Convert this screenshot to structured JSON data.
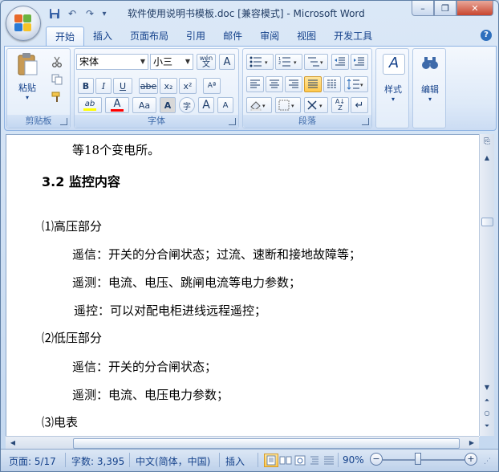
{
  "window": {
    "title": "软件使用说明书模板.doc [兼容模式] - Microsoft Word",
    "minimize_glyph": "–",
    "restore_glyph": "❐",
    "close_glyph": "✕"
  },
  "quick_access": {
    "save_icon": "save-icon",
    "undo_glyph": "↶",
    "redo_glyph": "↷",
    "customize_glyph": "▾"
  },
  "tabs": [
    {
      "label": "开始",
      "active": true
    },
    {
      "label": "插入"
    },
    {
      "label": "页面布局"
    },
    {
      "label": "引用"
    },
    {
      "label": "邮件"
    },
    {
      "label": "审阅"
    },
    {
      "label": "视图"
    },
    {
      "label": "开发工具"
    }
  ],
  "help_glyph": "?",
  "ribbon": {
    "clipboard": {
      "label": "剪贴板",
      "paste_label": "粘贴"
    },
    "font": {
      "label": "字体",
      "font_name": "宋体",
      "font_size": "小三",
      "phonetic_label": "wén",
      "bold": "B",
      "italic": "I",
      "underline": "U",
      "strike": "abe",
      "subscript": "x₂",
      "superscript": "x²",
      "grow": "A",
      "shrink": "A",
      "text_color_glyph": "A",
      "change_case": "Aa",
      "char_shading": "A",
      "enclose": "字",
      "highlight_glyph": "ab"
    },
    "paragraph": {
      "label": "段落"
    },
    "styles": {
      "label": "样式"
    },
    "editing": {
      "label": "编辑"
    }
  },
  "document": {
    "lines": [
      {
        "text": "等18个变电所。"
      },
      {
        "text": "3.2  监控内容",
        "heading": true
      },
      {
        "text": "⑴高压部分"
      },
      {
        "text": "遥信：开关的分合闸状态；过流、速断和接地故障等；"
      },
      {
        "text": "遥测：电流、电压、跳闸电流等电力参数；"
      },
      {
        "text": "遥控：可以对配电柜进线远程遥控；"
      },
      {
        "text": "⑵低压部分"
      },
      {
        "text": "遥信：开关的分合闸状态；"
      },
      {
        "text": "遥测：电流、电压电力参数；"
      },
      {
        "text": "⑶电表"
      }
    ]
  },
  "statusbar": {
    "page": "页面: 5/17",
    "words": "字数: 3,395",
    "language": "中文(简体，中国)",
    "mode": "插入",
    "zoom": "90%",
    "zoom_out": "−",
    "zoom_in": "+"
  },
  "colors": {
    "accent": "#15428b",
    "ribbon_border": "#8db2e3",
    "highlight_yellow": "#ffff00",
    "font_color_red": "#ff0000",
    "active_view": "#ffc94d"
  }
}
